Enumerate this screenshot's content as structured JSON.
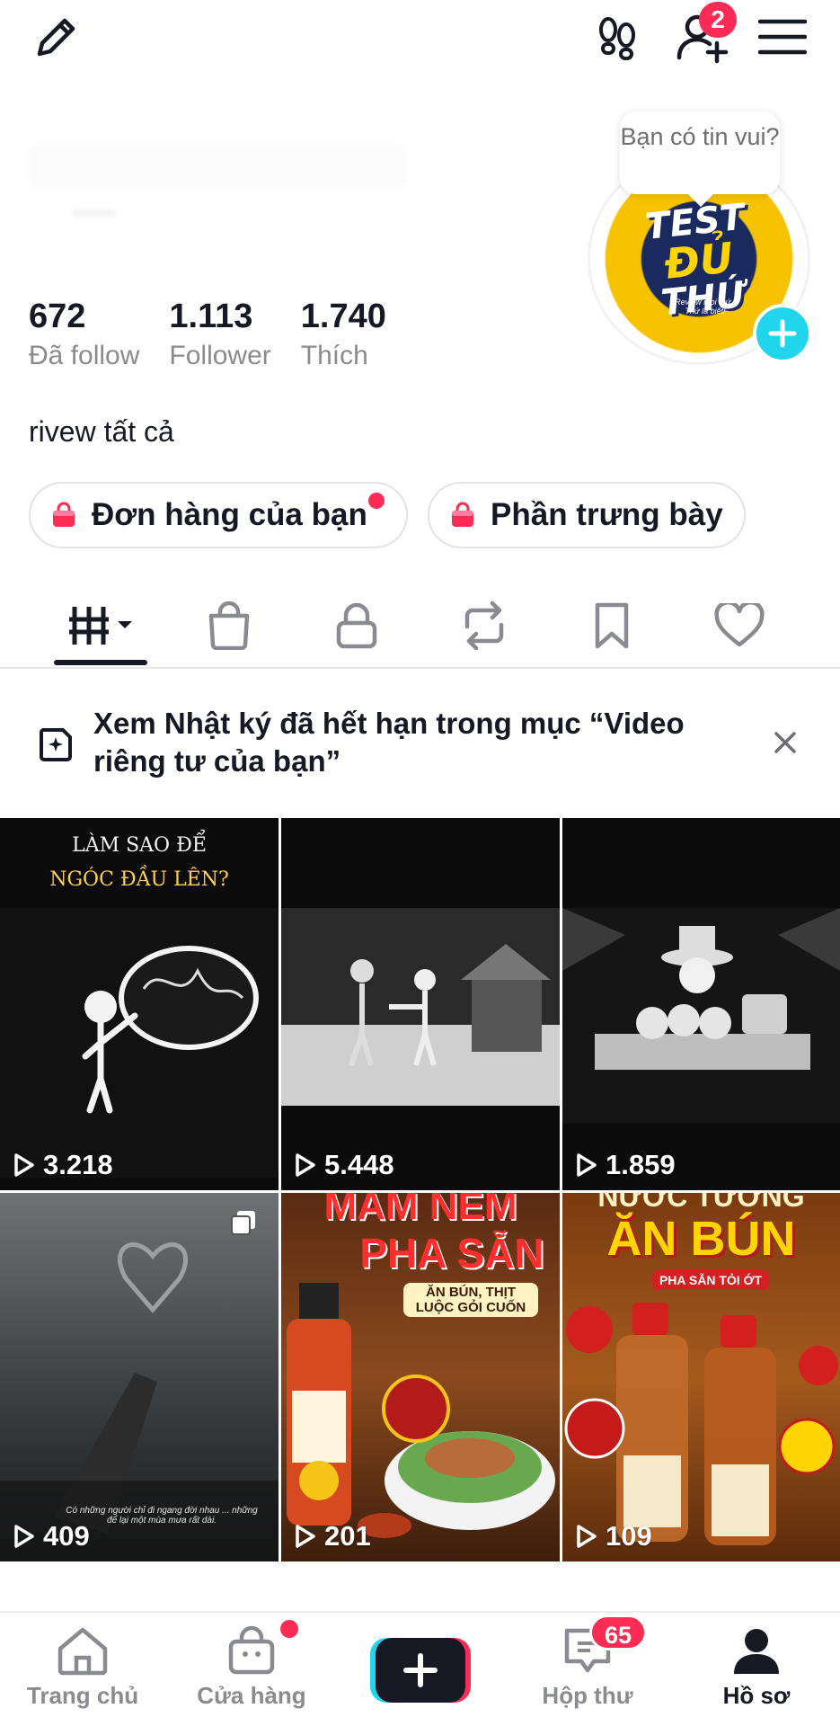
{
  "notifications": {
    "friend_badge": "2"
  },
  "avatar": {
    "line1": "TEST",
    "line2": "ĐỦ",
    "line3": "THỨ",
    "subtext": "Review mọi thứ · Thứ là biết!"
  },
  "bubble": {
    "text": "Bạn có tin vui?"
  },
  "stats": [
    {
      "value": "672",
      "label": "Đã follow"
    },
    {
      "value": "1.113",
      "label": "Follower"
    },
    {
      "value": "1.740",
      "label": "Thích"
    }
  ],
  "bio": "rivew tất cả",
  "pills": {
    "orders": "Đơn hàng của bạn",
    "showcase": "Phần trưng bày"
  },
  "notice": {
    "text": "Xem Nhật ký đã hết hạn trong mục “Video riêng tư của bạn”"
  },
  "videos": [
    {
      "views": "3.218",
      "caption_top": "LÀM SAO ĐỂ",
      "caption_bottom": "NGÓC ĐẦU LÊN?"
    },
    {
      "views": "5.448"
    },
    {
      "views": "1.859"
    },
    {
      "views": "409",
      "caption": "Có những người chỉ đi ngang đời nhau ... những để lại một mùa mưa rất dài."
    },
    {
      "views": "201",
      "title1": "MẮM NÊM",
      "title2": "PHA SẴN",
      "subtitle": "ĂN BÚN, THỊT LUỘC GỎI CUỐN"
    },
    {
      "views": "109",
      "title1": "NƯỚC TƯƠNG",
      "title2": "ĂN BÚN",
      "subtitle": "PHA SẴN TỎI ỚT"
    }
  ],
  "nav": {
    "home": "Trang chủ",
    "shop": "Cửa hàng",
    "inbox": "Hộp thư",
    "inbox_badge": "65",
    "profile": "Hồ sơ"
  },
  "colors": {
    "accent": "#fe2c55",
    "cyan": "#20d5ec",
    "text": "#161823",
    "muted": "#8a8b91"
  }
}
